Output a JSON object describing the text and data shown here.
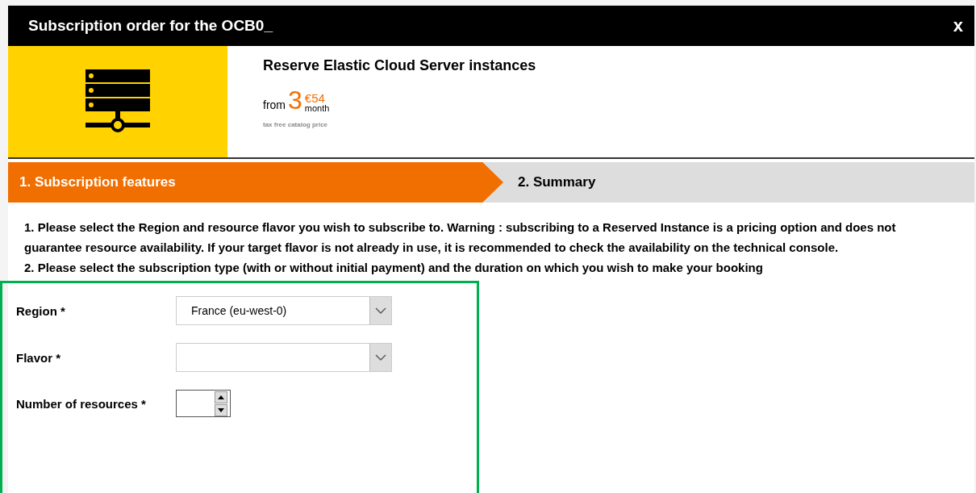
{
  "dialog": {
    "title": "Subscription order for the OCB0_",
    "close": "x"
  },
  "product": {
    "name": "Reserve Elastic Cloud Server instances",
    "price_prefix": "from",
    "price_main": "3",
    "price_cents": "€54",
    "price_unit": "month",
    "price_note": "tax free catalog price"
  },
  "steps": [
    {
      "label": "1. Subscription features",
      "selected": true
    },
    {
      "label": "2. Summary",
      "selected": false
    }
  ],
  "instructions": [
    "1. Please select the Region and resource flavor you wish to subscribe to. Warning : subscribing to a Reserved Instance is a pricing option and does not guarantee resource availability. If your target flavor is not already in use, it is recommended to check the availability on the technical console.",
    "2. Please select the subscription type (with or without initial payment) and the duration on which you wish to make your booking"
  ],
  "form": {
    "highlighted": true,
    "fields": [
      {
        "kind": "select",
        "label": "Region *",
        "value": "France (eu-west-0)"
      },
      {
        "kind": "select",
        "label": "Flavor *"
      },
      {
        "kind": "number",
        "label": "Number of resources *"
      }
    ]
  }
}
